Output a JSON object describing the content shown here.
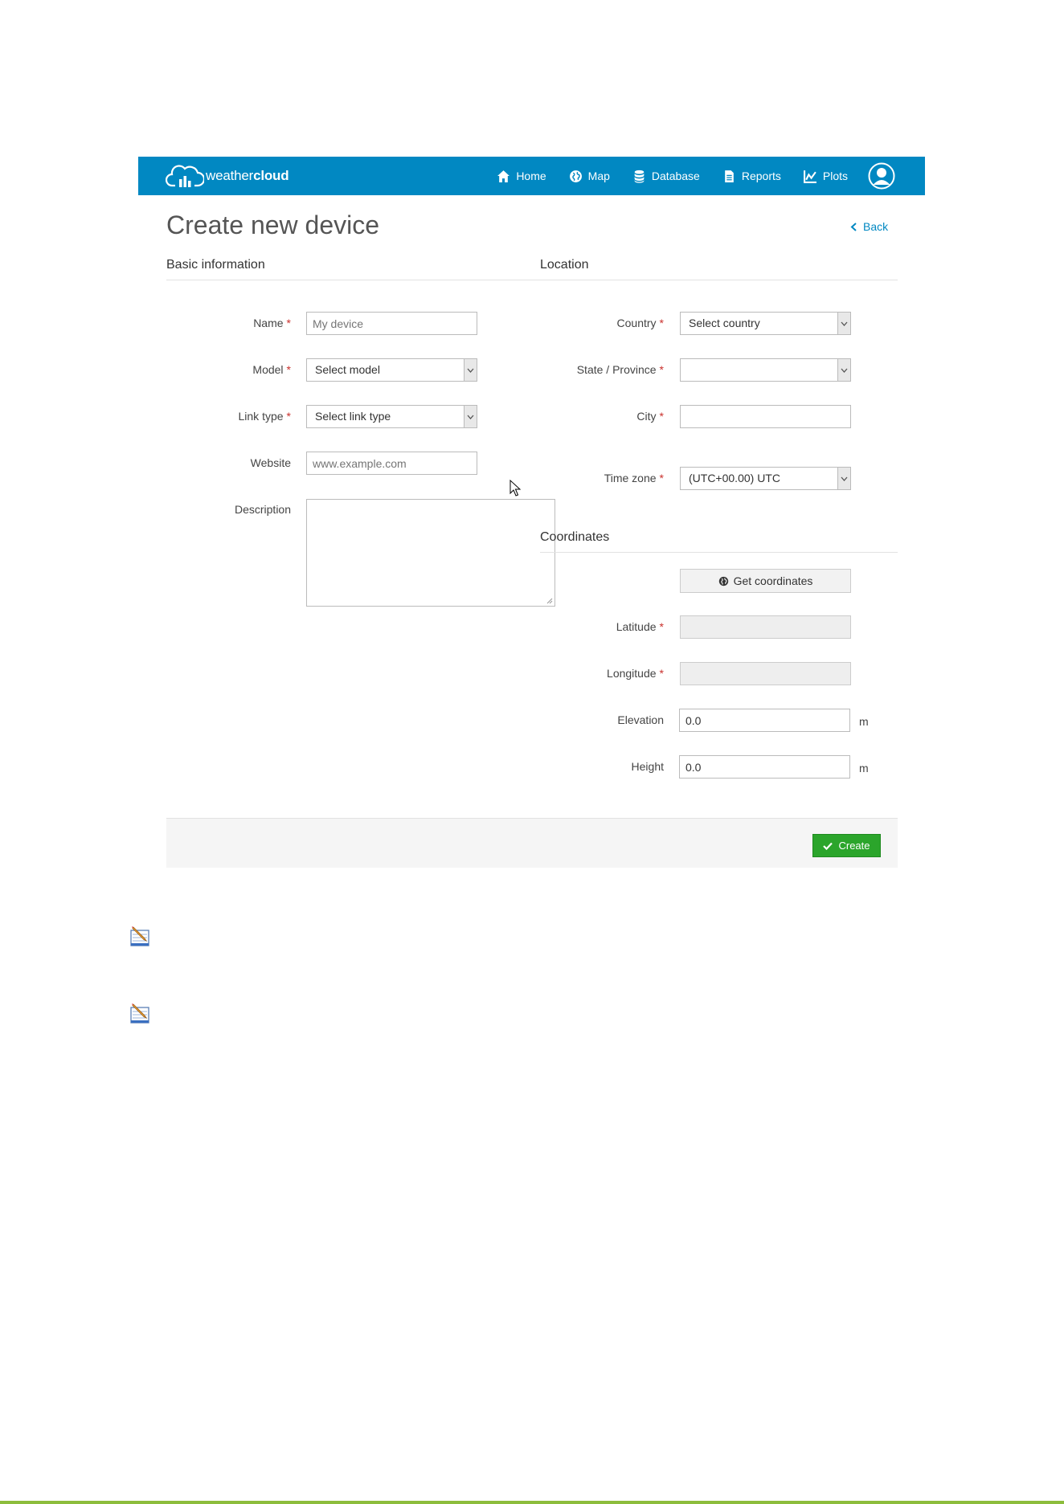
{
  "navbar": {
    "brand_prefix": "weather",
    "brand_suffix": "cloud",
    "brand_color": "#0188c2",
    "items": [
      {
        "label": "Home",
        "icon": "home-icon"
      },
      {
        "label": "Map",
        "icon": "globe-icon"
      },
      {
        "label": "Database",
        "icon": "database-icon"
      },
      {
        "label": "Reports",
        "icon": "document-icon"
      },
      {
        "label": "Plots",
        "icon": "line-chart-icon"
      }
    ],
    "user_icon": "user-avatar-icon"
  },
  "page": {
    "title": "Create new device",
    "back_label": "Back"
  },
  "basic": {
    "section_title": "Basic information",
    "name": {
      "label": "Name",
      "placeholder": "My device"
    },
    "model": {
      "label": "Model",
      "value": "Select model"
    },
    "link_type": {
      "label": "Link type",
      "value": "Select link type"
    },
    "website": {
      "label": "Website",
      "placeholder": "www.example.com"
    },
    "description": {
      "label": "Description",
      "value": ""
    }
  },
  "location": {
    "section_title": "Location",
    "country": {
      "label": "Country",
      "value": "Select country"
    },
    "state": {
      "label": "State / Province",
      "value": ""
    },
    "city": {
      "label": "City",
      "value": ""
    },
    "timezone": {
      "label": "Time zone",
      "value": "(UTC+00.00) UTC"
    }
  },
  "coordinates": {
    "section_title": "Coordinates",
    "get_button": "Get coordinates",
    "latitude": {
      "label": "Latitude",
      "value": ""
    },
    "longitude": {
      "label": "Longitude",
      "value": ""
    },
    "elevation": {
      "label": "Elevation",
      "value": "0.0",
      "unit": "m"
    },
    "height": {
      "label": "Height",
      "value": "0.0",
      "unit": "m"
    }
  },
  "required_marker": "*",
  "actions": {
    "create_label": "Create",
    "create_color": "#2ba52b"
  }
}
